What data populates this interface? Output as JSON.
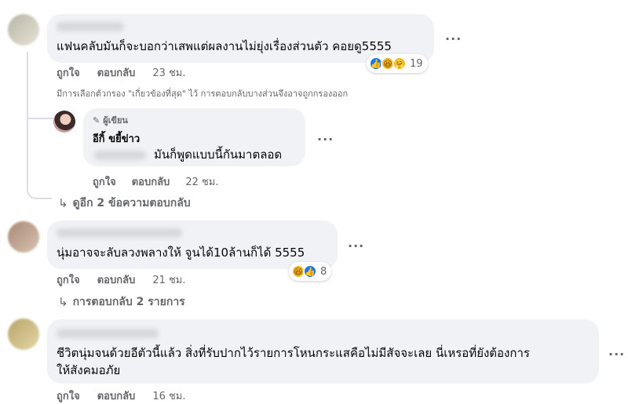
{
  "labels": {
    "like": "ถูกใจ",
    "reply": "ตอบกลับ",
    "more": "···"
  },
  "comments": [
    {
      "text": "แฟนคลับมันก็จะบอกว่าเสพแต่ผลงานไม่ยุ่งเรื่องส่วนตัว คอยดู5555",
      "time": "23 ชม.",
      "reaction_count": "19",
      "reactions": [
        "like-icon",
        "haha-icon",
        "care-icon"
      ]
    },
    {
      "text": "นุ่มอาจจะลับลวงพลางให้ จูนได้10ล้านก็ได้ 5555",
      "time": "21 ชม.",
      "reaction_count": "8",
      "reactions": [
        "haha-icon",
        "like-icon"
      ]
    },
    {
      "text_line1": "ชีวิตนุ่มจนด้วยอีตัวนี้แล้ว สิ่งที่รับปากไว้รายการโหนกระแสคือไม่มีสัจจะเลย นี่เหรอที่ยังต้องการ",
      "text_line2": "ให้สังคมอภัย",
      "time": "16 ชม."
    }
  ],
  "filter_note": "มีการเลือกตัวกรอง \"เกี่ยวข้องที่สุด\" ไว้ การตอบกลับบางส่วนจึงอาจถูกกรองออก",
  "author_reply": {
    "badge": "ผู้เขียน",
    "name": "อีกิ้ ขยี้ข่าว",
    "text": "มันก็พูดแบบนี้กันมาตลอด",
    "time": "22 ชม."
  },
  "view_more_replies": "ดูอีก 2 ข้อความตอบกลับ",
  "replies_link": "การตอบกลับ 2 รายการ",
  "colors": {
    "bubble": "#f0f2f5",
    "secondary_text": "#65676b",
    "like_blue": "#1877f2",
    "haha_yellow": "#f7b928"
  }
}
